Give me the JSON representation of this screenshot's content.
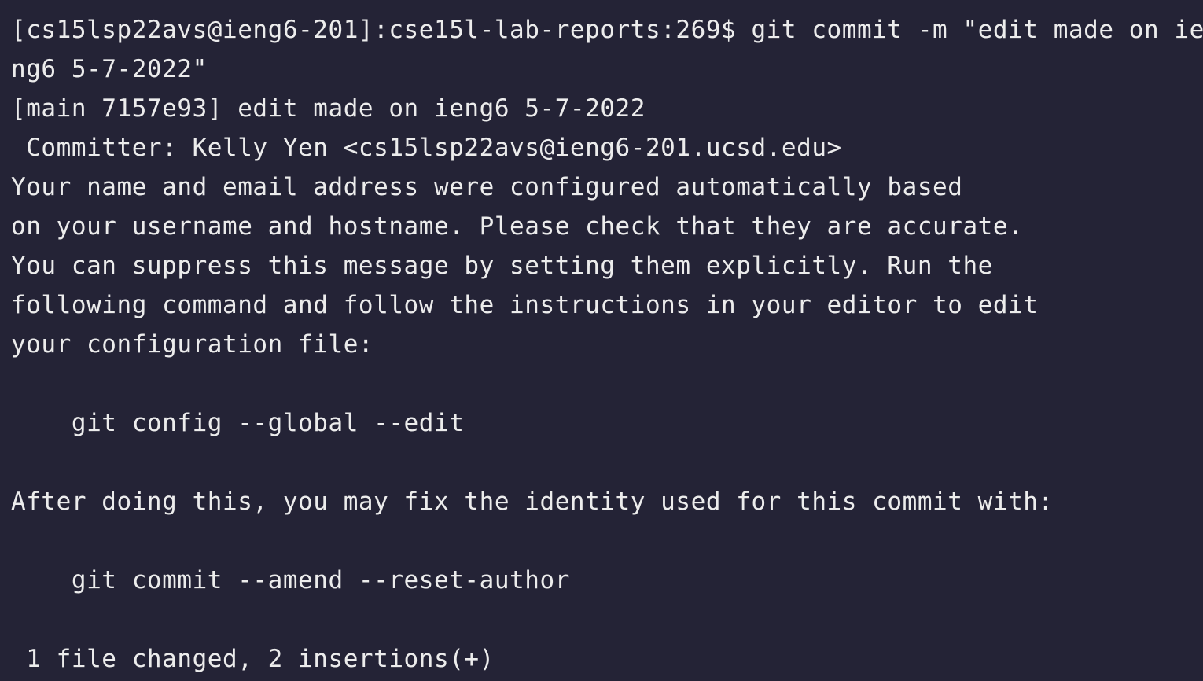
{
  "terminal": {
    "lines": [
      "[cs15lsp22avs@ieng6-201]:cse15l-lab-reports:269$ git commit -m \"edit made on ie",
      "ng6 5-7-2022\"",
      "[main 7157e93] edit made on ieng6 5-7-2022",
      " Committer: Kelly Yen <cs15lsp22avs@ieng6-201.ucsd.edu>",
      "Your name and email address were configured automatically based",
      "on your username and hostname. Please check that they are accurate.",
      "You can suppress this message by setting them explicitly. Run the",
      "following command and follow the instructions in your editor to edit",
      "your configuration file:",
      "",
      "    git config --global --edit",
      "",
      "After doing this, you may fix the identity used for this commit with:",
      "",
      "    git commit --amend --reset-author",
      "",
      " 1 file changed, 2 insertions(+)"
    ]
  },
  "colors": {
    "background": "#242336",
    "foreground": "#ECECEC"
  }
}
